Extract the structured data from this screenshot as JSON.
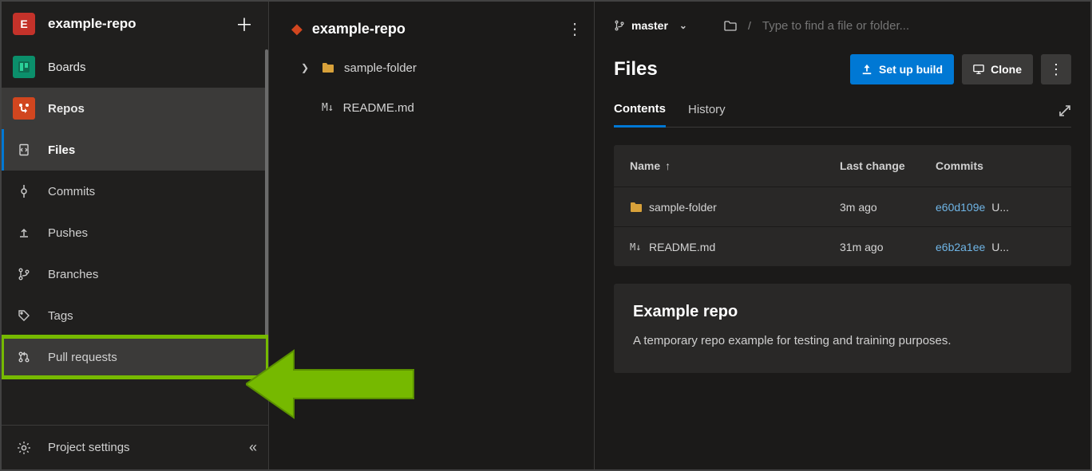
{
  "project": {
    "avatar_letter": "E",
    "name": "example-repo"
  },
  "sidebar": {
    "boards": "Boards",
    "repos": "Repos",
    "items": [
      {
        "label": "Files"
      },
      {
        "label": "Commits"
      },
      {
        "label": "Pushes"
      },
      {
        "label": "Branches"
      },
      {
        "label": "Tags"
      },
      {
        "label": "Pull requests"
      }
    ],
    "settings": "Project settings"
  },
  "tree": {
    "repo_name": "example-repo",
    "folder": "sample-folder",
    "file": "README.md"
  },
  "branch_bar": {
    "branch": "master",
    "path_placeholder": "Type to find a file or folder...",
    "crumb_sep": "/"
  },
  "header": {
    "title": "Files",
    "build_btn": "Set up build",
    "clone_btn": "Clone"
  },
  "tabs": {
    "contents": "Contents",
    "history": "History"
  },
  "table": {
    "head_name": "Name",
    "head_lastchange": "Last change",
    "head_commits": "Commits",
    "rows": [
      {
        "name": "sample-folder",
        "lastchange": "3m ago",
        "commit": "e60d109e",
        "tail": "U..."
      },
      {
        "name": "README.md",
        "lastchange": "31m ago",
        "commit": "e6b2a1ee",
        "tail": "U..."
      }
    ]
  },
  "readme": {
    "title": "Example repo",
    "body": "A temporary repo example for testing and training purposes."
  }
}
